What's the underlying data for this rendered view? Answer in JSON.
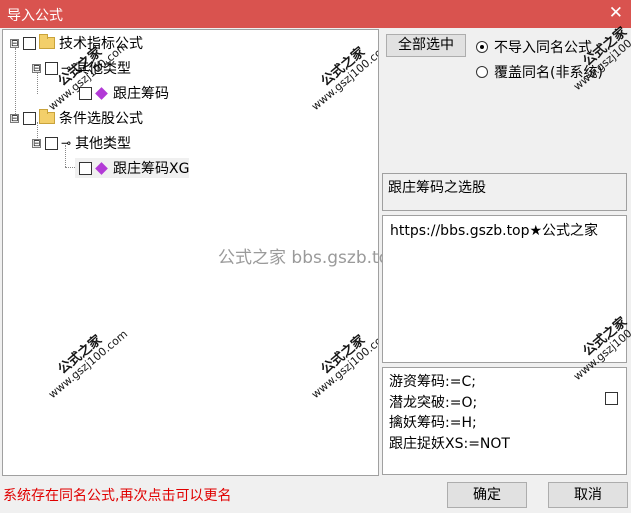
{
  "window": {
    "title": "导入公式",
    "close_glyph": "✕"
  },
  "tree": {
    "nodes": [
      {
        "label": "技术指标公式",
        "kind": "folder",
        "expander": "⊟"
      },
      {
        "label": "其他类型",
        "kind": "category",
        "expander": "⊟"
      },
      {
        "label": "跟庄筹码",
        "kind": "formula"
      },
      {
        "label": "条件选股公式",
        "kind": "folder",
        "expander": "⊟"
      },
      {
        "label": "其他类型",
        "kind": "category",
        "expander": "⊟"
      },
      {
        "label": "跟庄筹码XG",
        "kind": "formula"
      }
    ]
  },
  "right": {
    "select_all_label": "全部选中",
    "radio_options": [
      {
        "label": "不导入同名公式",
        "selected": true
      },
      {
        "label": "覆盖同名(非系统)",
        "selected": false
      }
    ],
    "formula_name": "跟庄筹码之选股",
    "description": "https://bbs.gszb.top★公式之家",
    "params": [
      "游资筹码:=C;",
      "潜龙突破:=O;",
      "擒妖筹码:=H;",
      "跟庄捉妖XS:=NOT"
    ]
  },
  "status_message": "系统存在同名公式,再次点击可以更名",
  "buttons": {
    "ok": "确定",
    "cancel": "取消"
  },
  "watermarks": {
    "mark": "公式之家",
    "url": "www.gszj100.com",
    "center": "公式之家 bbs.gszb.top"
  }
}
